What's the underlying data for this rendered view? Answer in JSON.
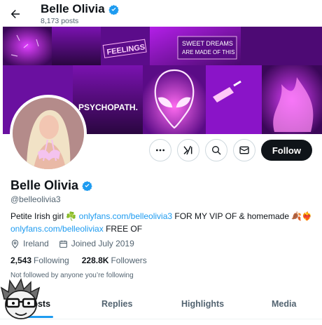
{
  "header": {
    "title": "Belle Olivia",
    "post_count": "8,173 posts"
  },
  "banner": {
    "texts": [
      "SWEET DREAMS",
      "ARE MADE OF THIS",
      "PSYCHOPATH.",
      "FEELINGS"
    ]
  },
  "profile": {
    "name": "Belle Olivia",
    "handle": "@belleolivia3",
    "bio": {
      "part1": "Petite Irish girl ☘️ ",
      "link1": "onlyfans.com/belleolivia3",
      "part2": " FOR MY VIP OF & homemade 🍂❤️‍🔥",
      "link2": "onlyfans.com/belleoliviax",
      "part3": " FREE OF"
    },
    "location": "Ireland",
    "joined": "Joined July 2019",
    "following_count": "2,543",
    "following_label": "Following",
    "followers_count": "228.8K",
    "followers_label": "Followers",
    "not_followed": "Not followed by anyone you’re following"
  },
  "actions": {
    "follow_label": "Follow"
  },
  "tabs": [
    {
      "label": "Posts"
    },
    {
      "label": "Replies"
    },
    {
      "label": "Highlights"
    },
    {
      "label": "Media"
    }
  ],
  "colors": {
    "accent": "#1d9bf0",
    "text": "#0f1419",
    "muted": "#536471",
    "banner": "#8a14c8"
  }
}
